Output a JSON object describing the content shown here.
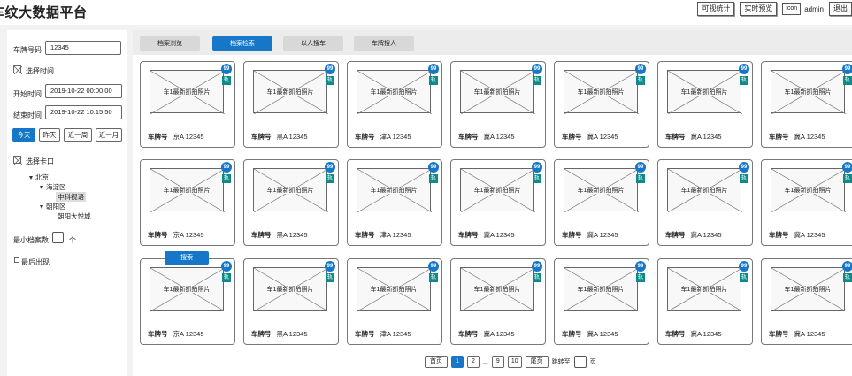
{
  "app_title": "车纹大数据平台",
  "top": {
    "visual_stats": "可视统计",
    "realtime_preview": "实时预览",
    "icon_label": "icon",
    "username": "admin",
    "logout": "退出"
  },
  "sidebar": {
    "plate_label": "车牌号码",
    "plate_value": "12345",
    "select_time": "选择时间",
    "start_label": "开始时间",
    "start_value": "2019-10-22 00:00:00",
    "end_label": "结束时间",
    "end_value": "2019-10-22 10:15:50",
    "quick": [
      "今天",
      "昨天",
      "近一周",
      "近一月"
    ],
    "select_checkpoint": "选择卡口",
    "tree": [
      "北京",
      "海淀区",
      "中科视语",
      "朝阳区",
      "朝阳大悦城"
    ],
    "min_archive_label": "最小档案数",
    "min_archive_unit": "个",
    "latest_appear": "最后出现"
  },
  "tabs": [
    "档案浏览",
    "档案检索",
    "以人搜车",
    "车牌搜人"
  ],
  "active_tab": 1,
  "card_photo_label": "车1最新抓拍照片",
  "card_plate_label": "车牌号",
  "card_badge": "99",
  "card_track": "轨",
  "search_button": "搜索",
  "plates_row": [
    "京A 12345",
    "黑A 12345",
    "津A 12345",
    "冀A 12345",
    "冀A 12345",
    "冀A 12345",
    "冀A 12345"
  ],
  "pager": {
    "first": "首页",
    "pages": [
      "1",
      "2",
      "...",
      "9",
      "10"
    ],
    "last": "尾页",
    "jump_label": "跳转至",
    "page_unit": "页"
  }
}
